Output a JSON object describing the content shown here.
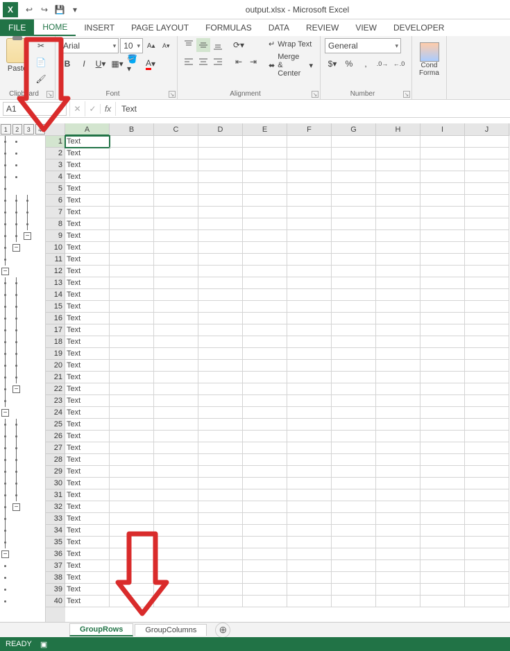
{
  "app": {
    "title": "output.xlsx - Microsoft Excel"
  },
  "ribbon": {
    "tabs": [
      "FILE",
      "HOME",
      "INSERT",
      "PAGE LAYOUT",
      "FORMULAS",
      "DATA",
      "REVIEW",
      "VIEW",
      "DEVELOPER"
    ],
    "active_tab": 1,
    "clipboard": {
      "paste": "Paste",
      "label": "Clipboard"
    },
    "font": {
      "name": "Arial",
      "size": "10",
      "label": "Font"
    },
    "alignment": {
      "wrap": "Wrap Text",
      "merge": "Merge & Center",
      "label": "Alignment"
    },
    "number": {
      "format": "General",
      "label": "Number"
    },
    "styles": {
      "cond": "Cond",
      "format": "Forma"
    }
  },
  "formula_bar": {
    "name_box": "A1",
    "fx": "fx",
    "value": "Text"
  },
  "grid": {
    "columns": [
      "A",
      "B",
      "C",
      "D",
      "E",
      "F",
      "G",
      "H",
      "I",
      "J"
    ],
    "active_column": 0,
    "active_row": 0,
    "row_count": 40,
    "cell_value": "Text",
    "outline_levels": [
      "1",
      "2",
      "3",
      "4"
    ]
  },
  "sheet_tabs": {
    "tabs": [
      "GroupRows",
      "GroupColumns"
    ],
    "active": 0
  },
  "status": {
    "mode": "READY"
  },
  "colors": {
    "accent": "#217346",
    "annotation": "#d92b2b"
  }
}
